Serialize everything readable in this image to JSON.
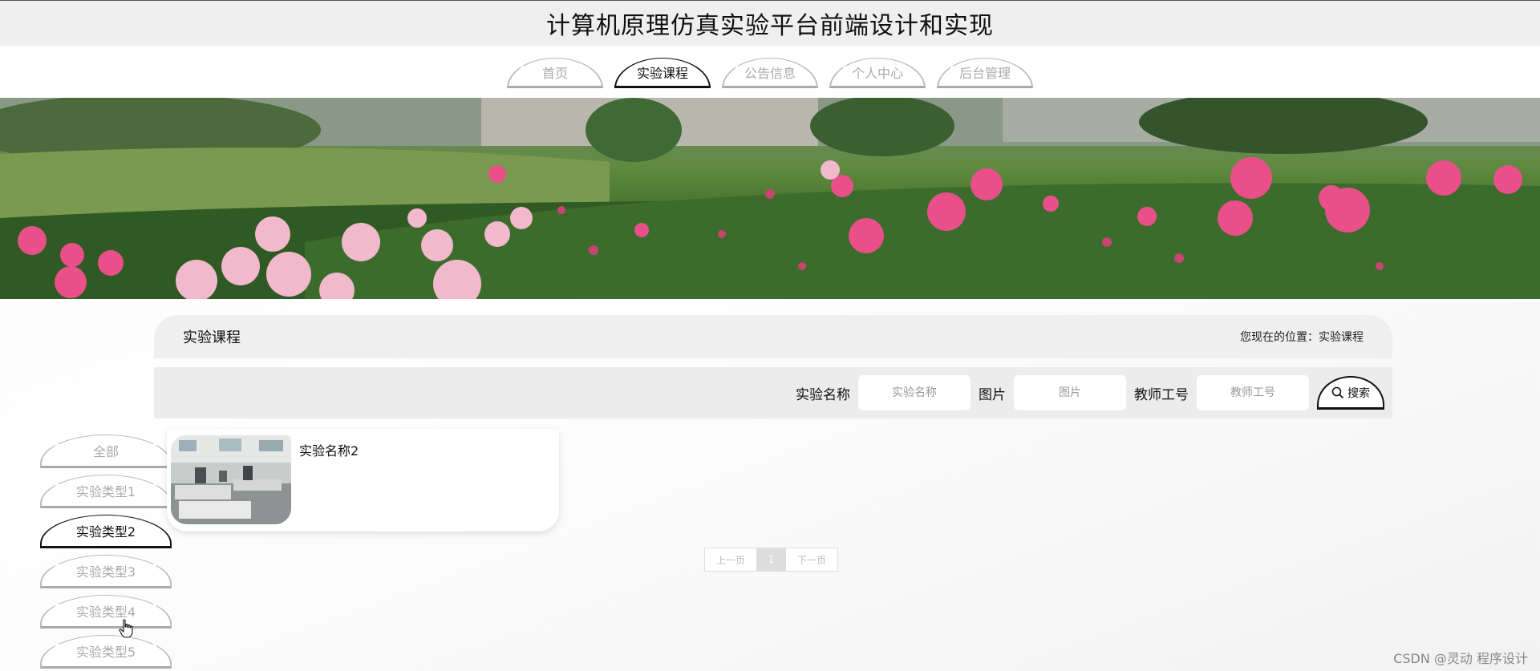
{
  "header": {
    "title": "计算机原理仿真实验平台前端设计和实现"
  },
  "nav": {
    "tabs": [
      {
        "label": "首页",
        "active": false
      },
      {
        "label": "实验课程",
        "active": true
      },
      {
        "label": "公告信息",
        "active": false
      },
      {
        "label": "个人中心",
        "active": false
      },
      {
        "label": "后台管理",
        "active": false
      }
    ]
  },
  "section": {
    "title": "实验课程",
    "breadcrumb": "您现在的位置：实验课程"
  },
  "search": {
    "name_label": "实验名称",
    "name_placeholder": "实验名称",
    "image_label": "图片",
    "image_placeholder": "图片",
    "teacher_label": "教师工号",
    "teacher_placeholder": "教师工号",
    "button_label": "搜索"
  },
  "categories": [
    {
      "label": "全部",
      "active": false
    },
    {
      "label": "实验类型1",
      "active": false
    },
    {
      "label": "实验类型2",
      "active": true
    },
    {
      "label": "实验类型3",
      "active": false
    },
    {
      "label": "实验类型4",
      "active": false
    },
    {
      "label": "实验类型5",
      "active": false
    }
  ],
  "results": [
    {
      "title": "实验名称2"
    }
  ],
  "pager": {
    "prev": "上一页",
    "current": "1",
    "next": "下一页"
  },
  "watermark": "CSDN @灵动 程序设计",
  "colors": {
    "accent": "#111111",
    "inactive": "#aaaaaa",
    "panel": "#efeff0"
  }
}
